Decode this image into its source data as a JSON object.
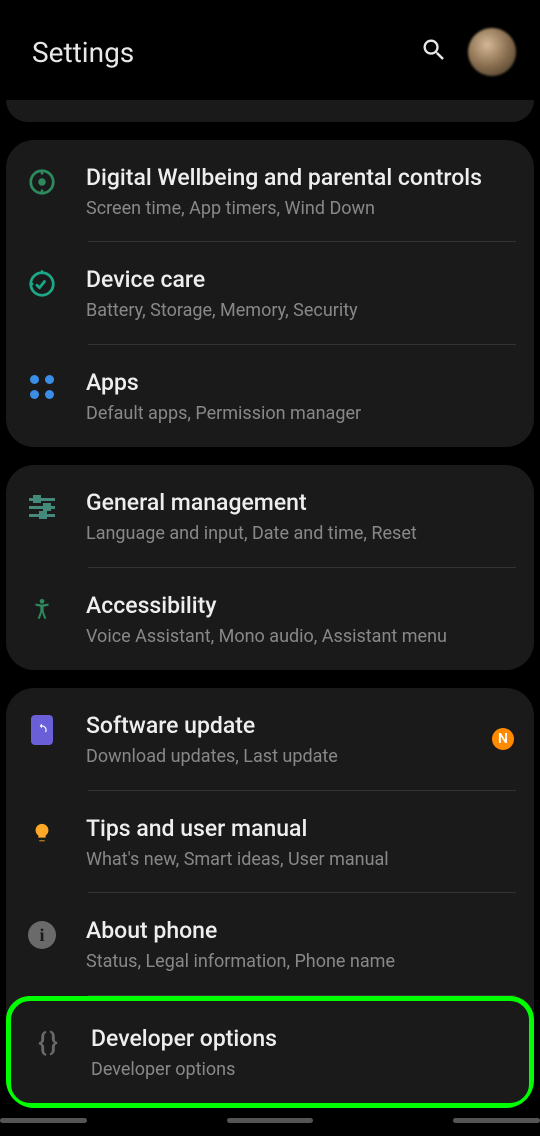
{
  "header": {
    "title": "Settings"
  },
  "groups": [
    {
      "items": [
        {
          "id": "digital-wellbeing",
          "title": "Digital Wellbeing and parental controls",
          "subtitle": "Screen time, App timers, Wind Down"
        },
        {
          "id": "device-care",
          "title": "Device care",
          "subtitle": "Battery, Storage, Memory, Security"
        },
        {
          "id": "apps",
          "title": "Apps",
          "subtitle": "Default apps, Permission manager"
        }
      ]
    },
    {
      "items": [
        {
          "id": "general-management",
          "title": "General management",
          "subtitle": "Language and input, Date and time, Reset"
        },
        {
          "id": "accessibility",
          "title": "Accessibility",
          "subtitle": "Voice Assistant, Mono audio, Assistant menu"
        }
      ]
    },
    {
      "items": [
        {
          "id": "software-update",
          "title": "Software update",
          "subtitle": "Download updates, Last update",
          "badge": "N"
        },
        {
          "id": "tips-manual",
          "title": "Tips and user manual",
          "subtitle": "What's new, Smart ideas, User manual"
        },
        {
          "id": "about-phone",
          "title": "About phone",
          "subtitle": "Status, Legal information, Phone name"
        },
        {
          "id": "developer-options",
          "title": "Developer options",
          "subtitle": "Developer options",
          "highlighted": true
        }
      ]
    }
  ]
}
